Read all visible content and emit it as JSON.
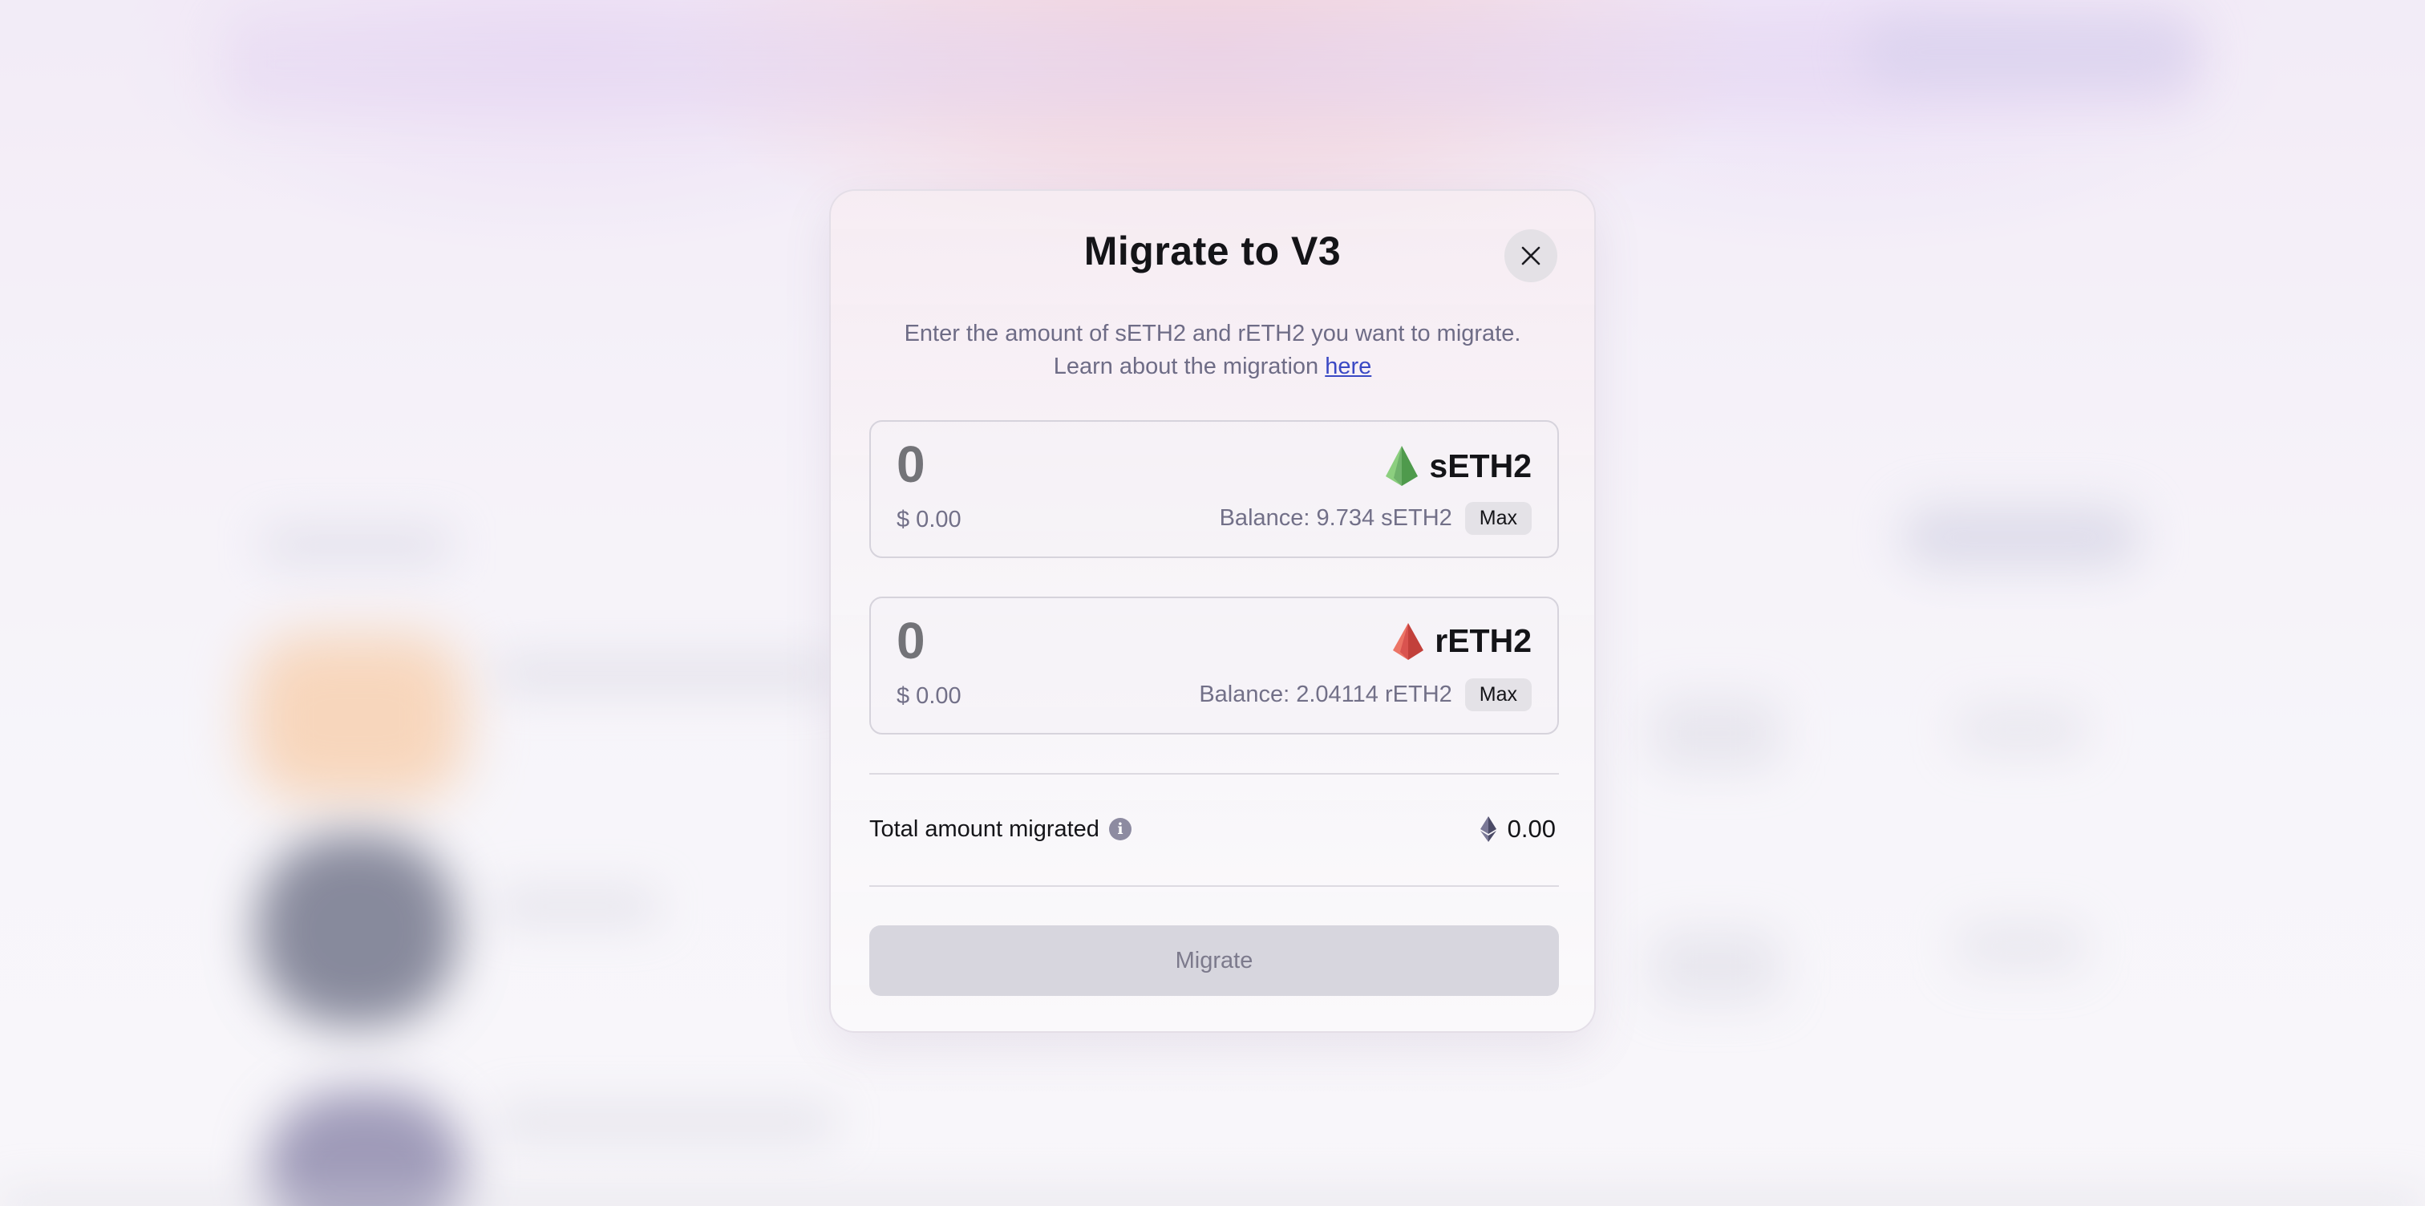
{
  "modal": {
    "title": "Migrate to V3",
    "close_icon": "close-icon",
    "description_line1": "Enter the amount of sETH2 and rETH2 you want to migrate.",
    "description_line2_prefix": "Learn about the migration ",
    "description_link": "here"
  },
  "tokens": [
    {
      "symbol": "sETH2",
      "icon": "green-ethereum-icon",
      "amount": "0",
      "usd_value": "$ 0.00",
      "balance_text": "Balance: 9.734 sETH2",
      "max_label": "Max",
      "color": "#6fb26b"
    },
    {
      "symbol": "rETH2",
      "icon": "red-ethereum-icon",
      "amount": "0",
      "usd_value": "$ 0.00",
      "balance_text": "Balance: 2.04114 rETH2",
      "max_label": "Max",
      "color": "#d9534f"
    }
  ],
  "total": {
    "label": "Total amount migrated",
    "info_icon": "info-icon",
    "value_icon": "ethereum-icon",
    "value": "0.00"
  },
  "action": {
    "migrate_label": "Migrate",
    "disabled": true
  },
  "colors": {
    "accent_link": "#3a48c4",
    "muted_text": "#6e6c86",
    "button_disabled_bg": "#d7d6de"
  }
}
